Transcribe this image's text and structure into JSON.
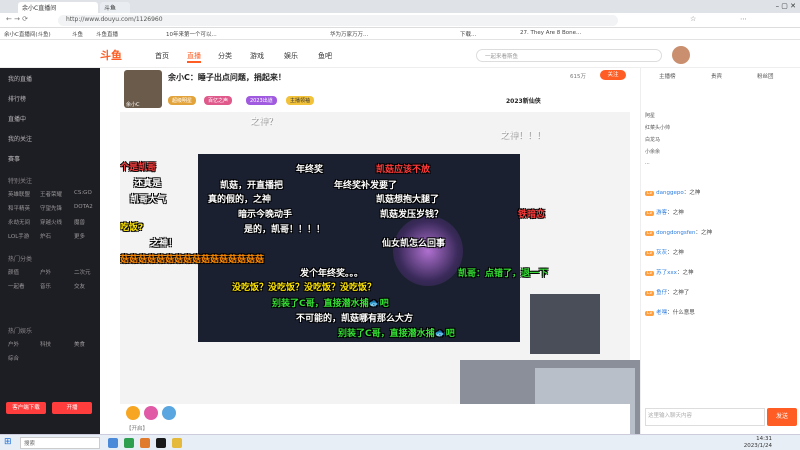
{
  "browser": {
    "tabs": [
      "余小C直播间",
      "斗鱼",
      "...",
      "..."
    ],
    "url": "http://www.douyu.com/1126960",
    "bookmarks": [
      "余小C直播间(斗鱼)",
      "斗鱼",
      "斗鱼直播",
      "...",
      "斗鱼直播",
      "斗鱼直播",
      "10年来第一个可以...",
      "华为万家万万...",
      "...",
      "下载...",
      "27. They Are 8 Bone..."
    ]
  },
  "site": {
    "logo": "斗鱼",
    "nav": [
      "首页",
      "直播",
      "分类",
      "游戏",
      "娱乐",
      "鱼吧"
    ],
    "search_placeholder": "一起来看斯鱼"
  },
  "sidebar": {
    "top_items": [
      "我的直播",
      "排行榜",
      "直播中",
      "我的关注",
      "赛事"
    ],
    "section1": "特别关注",
    "grid1": [
      "英雄联盟",
      "王者荣耀",
      "CS:GO",
      "和平精英",
      "守望先锋",
      "DOTA2",
      "永劫无间",
      "穿越火线",
      "魔兽",
      "LOL手游",
      "炉石",
      "更多"
    ],
    "section2": "热门分类",
    "grid2": [
      "颜值",
      "户外",
      "二次元",
      "一起看",
      "音乐",
      "交友"
    ],
    "section3": "热门娱乐",
    "grid3": [
      "户外",
      "科技",
      "美食",
      "综合"
    ],
    "bottom_buttons": [
      "客户端下载",
      "开播"
    ]
  },
  "room": {
    "streamer": "余小C",
    "title": "余小C：睡子出点问题，捐起来！",
    "badges": [
      "超级明星",
      "百亿之声",
      "2023出道",
      "主播领袖"
    ],
    "follow_label": "关注",
    "followers": "615万",
    "year_badge": "2023新仙侠"
  },
  "danmaku": [
    {
      "text": "之神？",
      "c": "w"
    },
    {
      "text": "个是凯哥",
      "c": "r"
    },
    {
      "text": "还真是",
      "c": "w"
    },
    {
      "text": "凯哥大气",
      "c": "w"
    },
    {
      "text": "吃饭?",
      "c": "y"
    },
    {
      "text": "之神！",
      "c": "w"
    },
    {
      "text": "年终奖",
      "c": "w"
    },
    {
      "text": "凯菇应该不放",
      "c": "r"
    },
    {
      "text": "凯菇，开直播把",
      "c": "w"
    },
    {
      "text": "年终奖补发要了",
      "c": "w"
    },
    {
      "text": "真的假的，之神",
      "c": "w"
    },
    {
      "text": "凯菇想抱大腿了",
      "c": "w"
    },
    {
      "text": "暗示今晚动手",
      "c": "w"
    },
    {
      "text": "凯菇发压岁钱？",
      "c": "w"
    },
    {
      "text": "是的，凯哥！！！！",
      "c": "w"
    },
    {
      "text": "菇菇菇菇菇菇菇菇菇菇菇菇菇菇菇菇",
      "c": "o"
    },
    {
      "text": "仙女凯怎么回事",
      "c": "w"
    },
    {
      "text": "发个年终奖。。。",
      "c": "w"
    },
    {
      "text": "没吃饭？没吃饭？没吃饭？没吃饭？",
      "c": "y"
    },
    {
      "text": "别装了C哥，直接潜水捕🐟吧",
      "c": "g"
    },
    {
      "text": "凯哥：点错了，退一下",
      "c": "g"
    },
    {
      "text": "不可能的，凯菇哪有那么大方",
      "c": "w"
    },
    {
      "text": "别装了C哥，直接潜水捕🐟吧",
      "c": "g"
    },
    {
      "text": "铁暗恋",
      "c": "r"
    },
    {
      "text": "之神！！！",
      "c": "w"
    }
  ],
  "chat": {
    "tabs": [
      "主播榜",
      "贵宾",
      "粉丝团"
    ],
    "ranks": [
      "阿星",
      "红菜头小帅",
      "白龙马",
      "小余余",
      "..."
    ],
    "messages": [
      {
        "user": "danggepo",
        "text": "之神"
      },
      {
        "user": "游客",
        "text": "之神"
      },
      {
        "user": "dongdongsfen",
        "text": "之神"
      },
      {
        "user": "灰灰",
        "text": "之神"
      },
      {
        "user": "苏了xxx",
        "text": "之神"
      },
      {
        "user": "鱼仔",
        "text": "之神了"
      },
      {
        "user": "老嘿",
        "text": "什么意思"
      }
    ],
    "input_placeholder": "这里输入聊天内容",
    "send_label": "发送"
  },
  "gift_bar": {
    "label": "【开启】"
  },
  "taskbar": {
    "search_placeholder": "搜索",
    "time": "14:31",
    "date": "2023/1/24"
  },
  "colors": {
    "accent": "#ff5d23",
    "sidebar_bg": "#1d1d24"
  }
}
